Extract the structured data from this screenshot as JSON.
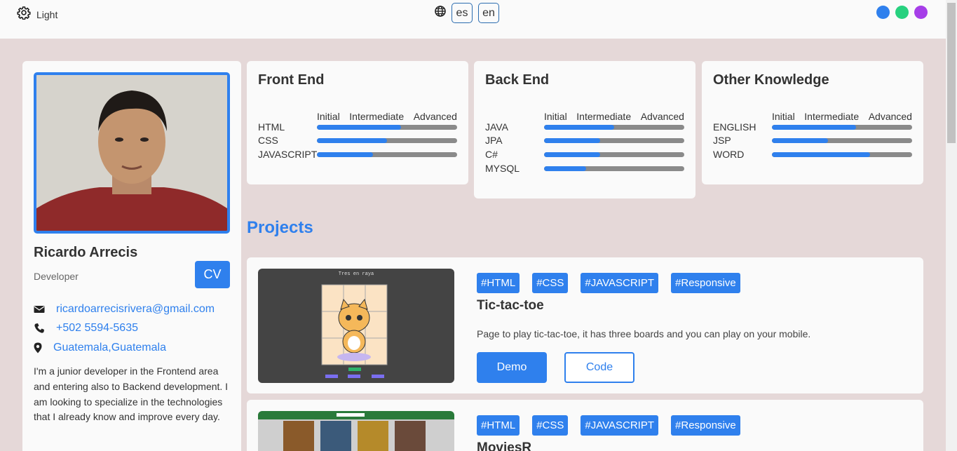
{
  "header": {
    "theme_label": "Light",
    "languages": [
      "es",
      "en"
    ],
    "color_options": [
      "#2f80ed",
      "#27d17f",
      "#a63ee8"
    ]
  },
  "profile": {
    "name": "Ricardo Arrecis",
    "role": "Developer",
    "cv_label": "CV",
    "email": "ricardoarrecisrivera@gmail.com",
    "phone": "+502 5594-5635",
    "location": "Guatemala,Guatemala",
    "bio": "I'm a junior developer in the Frontend area and entering also to Backend development. I am looking to specialize in the technologies that I already know and improve every day."
  },
  "skills": {
    "levels": [
      "Initial",
      "Intermediate",
      "Advanced"
    ],
    "cards": [
      {
        "title": "Front End",
        "items": [
          {
            "name": "HTML",
            "level": 0.6
          },
          {
            "name": "CSS",
            "level": 0.5
          },
          {
            "name": "JAVASCRIPT",
            "level": 0.4
          }
        ]
      },
      {
        "title": "Back End",
        "items": [
          {
            "name": "JAVA",
            "level": 0.5
          },
          {
            "name": "JPA",
            "level": 0.4
          },
          {
            "name": "C#",
            "level": 0.4
          },
          {
            "name": "MYSQL",
            "level": 0.3
          }
        ]
      },
      {
        "title": "Other Knowledge",
        "items": [
          {
            "name": "ENGLISH",
            "level": 0.6
          },
          {
            "name": "JSP",
            "level": 0.4
          },
          {
            "name": "WORD",
            "level": 0.7
          }
        ]
      }
    ]
  },
  "projects": {
    "title": "Projects",
    "items": [
      {
        "tags": [
          "#HTML",
          "#CSS",
          "#JAVASCRIPT",
          "#Responsive"
        ],
        "name": "Tic-tac-toe",
        "description": "Page to play tic-tac-toe, it has three boards and you can play on your mobile.",
        "demo_label": "Demo",
        "code_label": "Code",
        "thumb_title": "Tres en raya"
      },
      {
        "tags": [
          "#HTML",
          "#CSS",
          "#JAVASCRIPT",
          "#Responsive"
        ],
        "name": "MoviesR"
      }
    ]
  }
}
